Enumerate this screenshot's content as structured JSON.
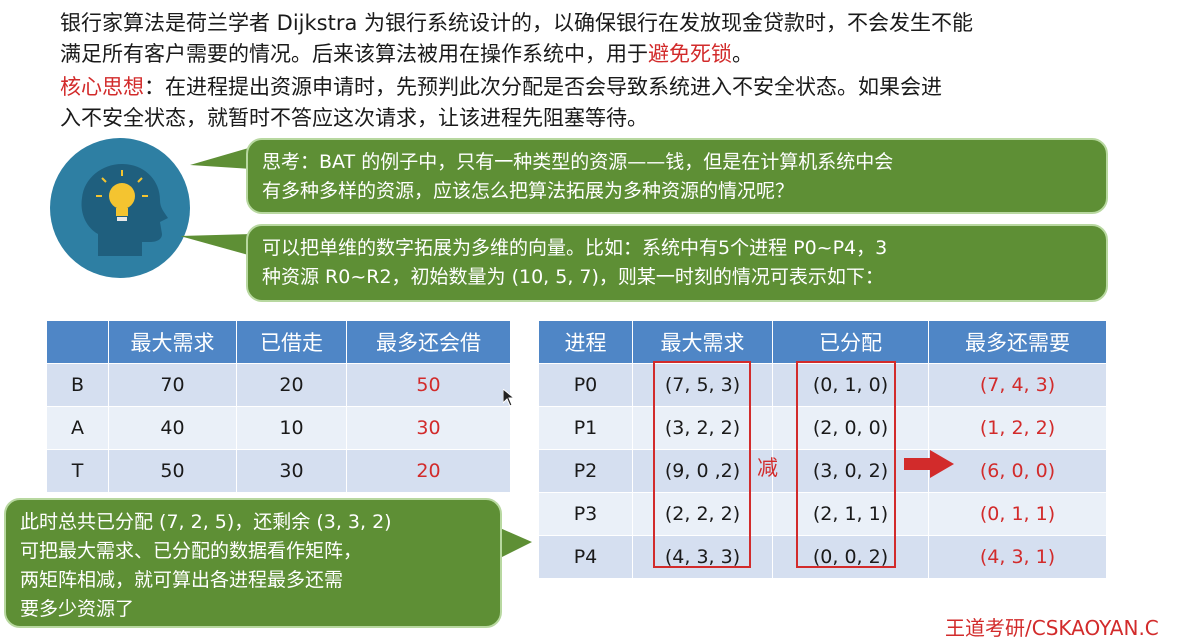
{
  "intro": {
    "line1": "银行家算法是荷兰学者 Dijkstra 为银行系统设计的，以确保银行在发放现金贷款时，不会发生不能",
    "line2_prefix": "满足所有客户需要的情况。后来该算法被用在操作系统中，用于",
    "line2_highlight": "避免死锁",
    "line2_suffix": "。"
  },
  "core": {
    "label": "核心思想",
    "line1_rest": "：在进程提出资源申请时，先预判此次分配是否会导致系统进入不安全状态。如果会进",
    "line2": "入不安全状态，就暂时不答应这次请求，让该进程先阻塞等待。"
  },
  "bubble_think": {
    "line1": "思考：BAT 的例子中，只有一种类型的资源——钱，但是在计算机系统中会",
    "line2": "有多种多样的资源，应该怎么把算法拓展为多种资源的情况呢？"
  },
  "bubble_answer": {
    "line1": "可以把单维的数字拓展为多维的向量。比如：系统中有5个进程 P0~P4，3",
    "line2": "种资源  R0~R2，初始数量为 (10, 5, 7)，则某一时刻的情况可表示如下："
  },
  "bubble_note": {
    "line1": "此时总共已分配 (7, 2, 5)，还剩余 (3, 3, 2)",
    "line2": "可把最大需求、已分配的数据看作矩阵，",
    "line3": "两矩阵相减，就可算出各进程最多还需",
    "line4": "要多少资源了"
  },
  "table_bank": {
    "headers": [
      "",
      "最大需求",
      "已借走",
      "最多还会借"
    ],
    "rows": [
      {
        "name": "B",
        "max": "70",
        "borrowed": "20",
        "more": "50"
      },
      {
        "name": "A",
        "max": "40",
        "borrowed": "10",
        "more": "30"
      },
      {
        "name": "T",
        "max": "50",
        "borrowed": "30",
        "more": "20"
      }
    ]
  },
  "table_proc": {
    "headers": [
      "进程",
      "最大需求",
      "已分配",
      "最多还需要"
    ],
    "rows": [
      {
        "proc": "P0",
        "max": "(7, 5, 3)",
        "alloc": "(0, 1, 0)",
        "need": "(7, 4, 3)"
      },
      {
        "proc": "P1",
        "max": "(3, 2, 2)",
        "alloc": "(2, 0, 0)",
        "need": "(1, 2, 2)"
      },
      {
        "proc": "P2",
        "max": "(9, 0 ,2)",
        "alloc": "(3, 0, 2)",
        "need": "(6, 0, 0)"
      },
      {
        "proc": "P3",
        "max": "(2, 2, 2)",
        "alloc": "(2, 1, 1)",
        "need": "(0, 1, 1)"
      },
      {
        "proc": "P4",
        "max": "(4, 3, 3)",
        "alloc": "(0, 0, 2)",
        "need": "(4, 3, 1)"
      }
    ]
  },
  "minus_label": "减",
  "footer": "王道考研/CSKAOYAN.C",
  "icons": {
    "head": "lightbulb-head-icon",
    "arrow": "right-arrow-icon",
    "cursor": "mouse-cursor-icon"
  },
  "colors": {
    "accent_red": "#d22b2b",
    "bubble_green": "#5e8f35",
    "table_header": "#4f86c6",
    "head_blue": "#2e7fa3"
  }
}
